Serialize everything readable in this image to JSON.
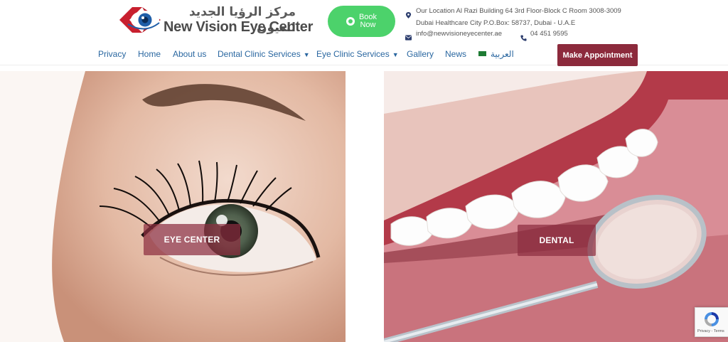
{
  "header": {
    "logo_arabic": "مركز الرؤيا الجديد للعيون",
    "logo_english": "New Vision Eye Center",
    "book_now": [
      "Book",
      "Now"
    ],
    "address_line1": "Our Location Al Razi Building 64 3rd Floor-Block C Room 3008-3009",
    "address_line2": "Dubai Healthcare City P.O.Box: 58737, Dubai - U.A.E",
    "email": "info@newvisioneyecenter.ae",
    "phone": "04 451 9595"
  },
  "nav": {
    "items": [
      {
        "label": "Privacy"
      },
      {
        "label": "Home"
      },
      {
        "label": "About us"
      },
      {
        "label": "Dental Clinic Services",
        "dropdown": true
      },
      {
        "label": "Eye Clinic Services",
        "dropdown": true
      },
      {
        "label": "Gallery"
      },
      {
        "label": "News"
      },
      {
        "label": "العربية",
        "flag": true
      }
    ],
    "appointment": "Make Appointment"
  },
  "hero": {
    "eye_label": "EYE CENTER",
    "dental_label": "DENTAL"
  },
  "recaptcha": {
    "text": "Privacy - Terms"
  },
  "colors": {
    "brand_maroon": "#8c2a3c",
    "whatsapp_green": "#4cd26b",
    "nav_blue": "#2a67a0"
  },
  "icons": [
    "location-pin-icon",
    "mail-icon",
    "phone-icon",
    "whatsapp-icon",
    "chevron-down-icon",
    "saudi-flag-icon",
    "recaptcha-icon"
  ]
}
